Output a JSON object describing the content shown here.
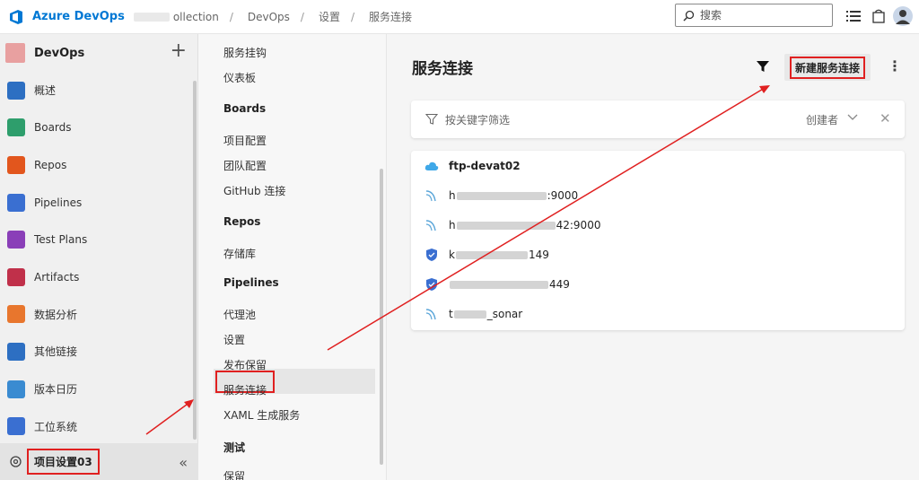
{
  "topbar": {
    "brand": "Azure DevOps",
    "collection": "ollection",
    "breadcrumb": [
      "DevOps",
      "设置",
      "服务连接"
    ],
    "search_placeholder": "搜索"
  },
  "sidebar": {
    "project": "DevOps",
    "items": [
      {
        "label": "概述",
        "icon": "overview-icon",
        "color": "#2d6fc2"
      },
      {
        "label": "Boards",
        "icon": "boards-icon",
        "color": "#2e9e6c"
      },
      {
        "label": "Repos",
        "icon": "repos-icon",
        "color": "#e2561d"
      },
      {
        "label": "Pipelines",
        "icon": "pipelines-icon",
        "color": "#3a6fd1"
      },
      {
        "label": "Test Plans",
        "icon": "test-plans-icon",
        "color": "#8a3fb8"
      },
      {
        "label": "Artifacts",
        "icon": "artifacts-icon",
        "color": "#c0304a"
      },
      {
        "label": "数据分析",
        "icon": "analytics-icon",
        "color": "#e8762d"
      },
      {
        "label": "其他链接",
        "icon": "link-icon",
        "color": "#2d6fc2"
      },
      {
        "label": "版本日历",
        "icon": "calendar-icon",
        "color": "#3a8bd1"
      },
      {
        "label": "工位系统",
        "icon": "workstation-icon",
        "color": "#3a6fd1"
      }
    ],
    "settings_label": "项目设置03"
  },
  "settings_nav": {
    "items": [
      {
        "label": "服务挂钩",
        "type": "item"
      },
      {
        "label": "仪表板",
        "type": "item"
      },
      {
        "label": "Boards",
        "type": "head"
      },
      {
        "label": "项目配置",
        "type": "item"
      },
      {
        "label": "团队配置",
        "type": "item"
      },
      {
        "label": "GitHub 连接",
        "type": "item"
      },
      {
        "label": "Repos",
        "type": "head"
      },
      {
        "label": "存储库",
        "type": "item"
      },
      {
        "label": "Pipelines",
        "type": "head"
      },
      {
        "label": "代理池",
        "type": "item"
      },
      {
        "label": "设置",
        "type": "item"
      },
      {
        "label": "发布保留",
        "type": "item"
      },
      {
        "label": "服务连接",
        "type": "item"
      },
      {
        "label": "XAML 生成服务",
        "type": "item"
      },
      {
        "label": "测试",
        "type": "head"
      },
      {
        "label": "保留",
        "type": "item"
      }
    ]
  },
  "main": {
    "title": "服务连接",
    "new_button": "新建服务连接",
    "filter_placeholder": "按关键字筛选",
    "creator_label": "创建者",
    "connections": [
      {
        "name_start": "ftp-devat02",
        "name_end": "",
        "icon": "cloud-icon"
      },
      {
        "name_start": "h",
        "name_end": ":9000",
        "icon": "sonar-icon"
      },
      {
        "name_start": "h",
        "name_end": "42:9000",
        "icon": "sonar-icon"
      },
      {
        "name_start": "k",
        "name_end": "149",
        "icon": "shield-icon"
      },
      {
        "name_start": "",
        "name_end": "449",
        "icon": "shield-icon"
      },
      {
        "name_start": "t",
        "name_end": "_sonar",
        "icon": "sonar-icon"
      }
    ]
  }
}
